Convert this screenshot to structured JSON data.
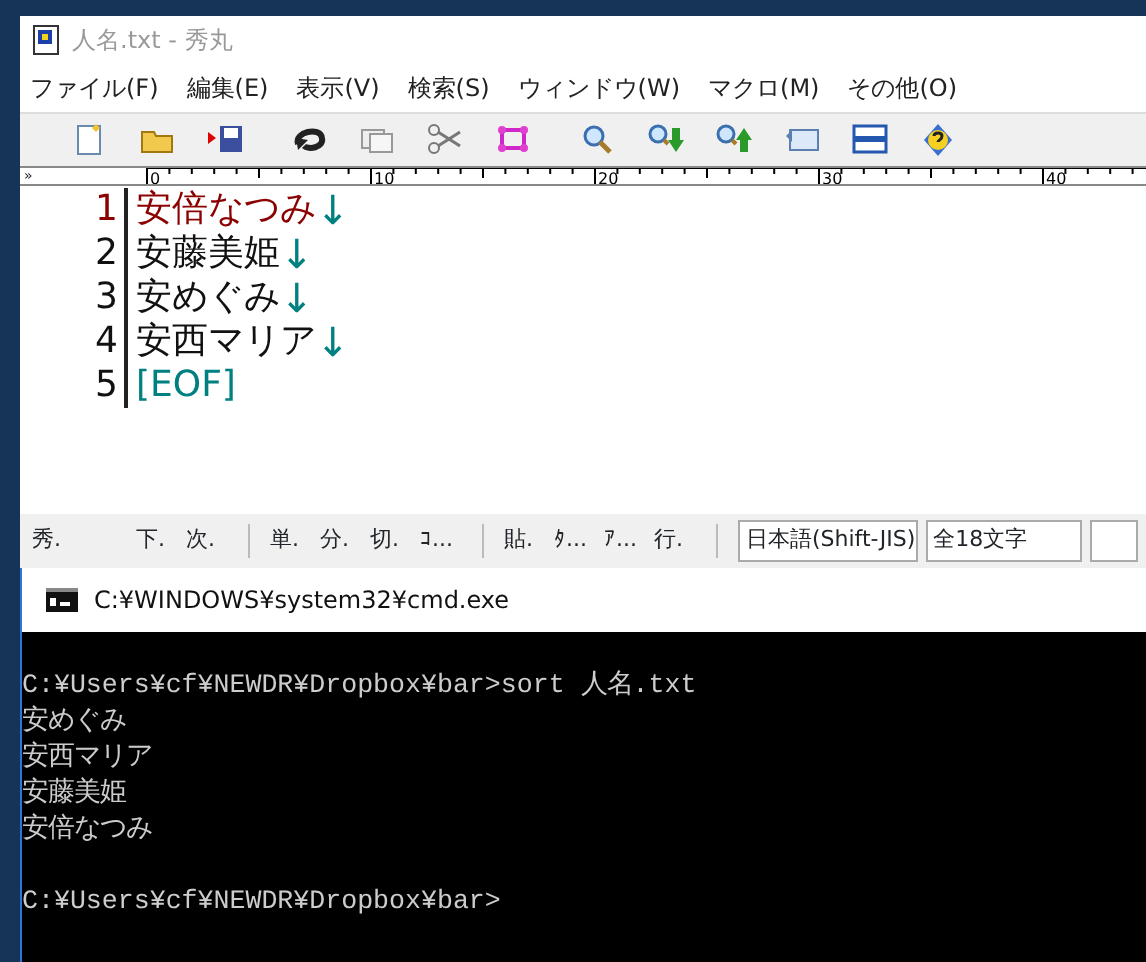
{
  "editor": {
    "title": "人名.txt - 秀丸",
    "menu": [
      "ファイル(F)",
      "編集(E)",
      "表示(V)",
      "検索(S)",
      "ウィンドウ(W)",
      "マクロ(M)",
      "その他(O)"
    ],
    "toolbar": [
      {
        "kind": "new"
      },
      {
        "kind": "open"
      },
      {
        "kind": "save"
      },
      {
        "kind": "undo"
      },
      {
        "kind": "copy"
      },
      {
        "kind": "cut"
      },
      {
        "kind": "paste"
      },
      {
        "kind": "search"
      },
      {
        "kind": "find-next"
      },
      {
        "kind": "find-prev"
      },
      {
        "kind": "tag"
      },
      {
        "kind": "window"
      },
      {
        "kind": "help"
      }
    ],
    "ruler_mark": "»",
    "ruler": [
      "0",
      "10",
      "20",
      "30",
      "40"
    ],
    "lines": [
      {
        "number": "1",
        "text": "安倍なつみ",
        "eol": "↓",
        "current": true
      },
      {
        "number": "2",
        "text": "安藤美姫",
        "eol": "↓",
        "current": false
      },
      {
        "number": "3",
        "text": "安めぐみ",
        "eol": "↓",
        "current": false
      },
      {
        "number": "4",
        "text": "安西マリア",
        "eol": "↓",
        "current": false
      },
      {
        "number": "5",
        "text": "[EOF]",
        "kind": "eof",
        "current": false
      }
    ],
    "status_groups": [
      [
        "秀.",
        "下.",
        "次."
      ],
      [
        "単.",
        "分.",
        "切.",
        "ｺ..."
      ],
      [
        "貼.",
        "ﾀ...",
        "ｱ...",
        "行."
      ]
    ],
    "status_fields": [
      "日本語(Shift-JIS)",
      "全18文字"
    ]
  },
  "console": {
    "title": "C:¥WINDOWS¥system32¥cmd.exe",
    "lines": [
      "C:¥Users¥cf¥NEWDR¥Dropbox¥bar>sort 人名.txt",
      "安めぐみ",
      "安西マリア",
      "安藤美姫",
      "安倍なつみ"
    ],
    "prompt": "C:¥Users¥cf¥NEWDR¥Dropbox¥bar>"
  }
}
